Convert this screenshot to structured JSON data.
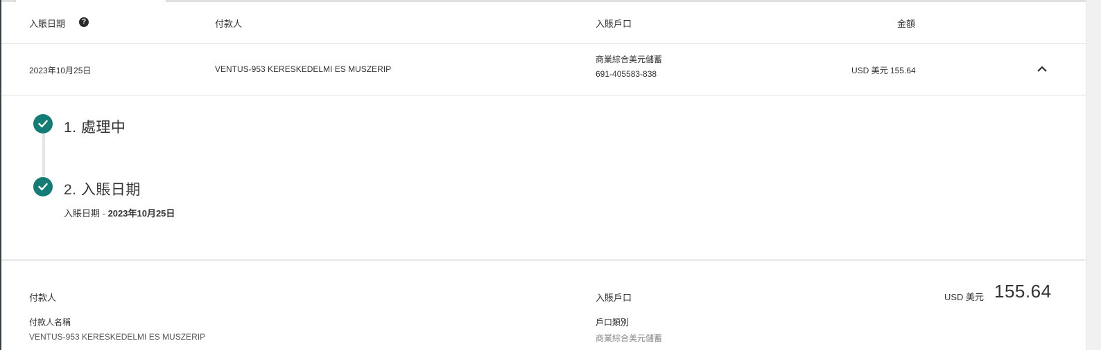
{
  "table": {
    "headers": {
      "posting_date": "入賬日期",
      "payer": "付款人",
      "deposit_account": "入賬戶口",
      "amount": "金額"
    },
    "row": {
      "date": "2023年10月25日",
      "payer": "VENTUS-953 KERESKEDELMI ES MUSZERIP",
      "account_type": "商業綜合美元儲蓄",
      "account_number": "691-405583-838",
      "amount": "USD 美元 155.64"
    }
  },
  "steps": [
    {
      "title": "1. 處理中",
      "status": "completed"
    },
    {
      "title": "2. 入賬日期",
      "status": "completed",
      "detail_label": "入賬日期 - ",
      "detail_value": "2023年10月25日"
    }
  ],
  "details": {
    "payer_section_title": "付款人",
    "payer_name_label": "付款人名稱",
    "payer_name_value": "VENTUS-953 KERESKEDELMI ES MUSZERIP",
    "account_section_title": "入賬戶口",
    "account_type_label": "戶口類別",
    "account_type_value": "商業綜合美元儲蓄",
    "amount_currency": "USD 美元",
    "amount_value": "155.64"
  },
  "colors": {
    "accent": "#137c74"
  },
  "icons": {
    "help": "question-circle-icon",
    "collapse": "chevron-up-icon",
    "step_done": "check-circle-icon"
  }
}
